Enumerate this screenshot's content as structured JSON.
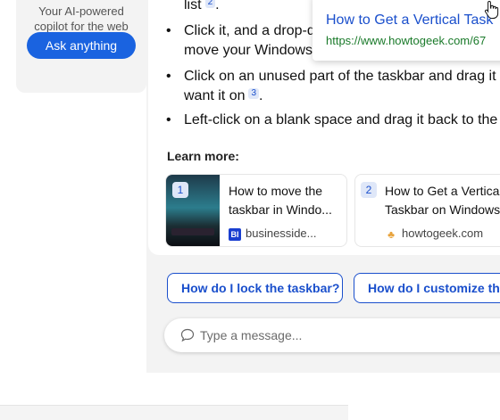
{
  "promo": {
    "text_line1": "Your AI-powered",
    "text_line2": "copilot for the web",
    "button_label": "Ask anything"
  },
  "answer": {
    "bullets": [
      {
        "line1": "list",
        "cite": "2",
        "line1_tail": "."
      },
      {
        "line1": "Click it, and a drop-d",
        "line2": "move your Windows"
      },
      {
        "line1": "Click on an unused part of the taskbar and drag it",
        "line2": "want it on",
        "cite": "3",
        "line2_tail": "."
      },
      {
        "line1": "Left-click on a blank space and drag it back to the"
      }
    ],
    "learn_more_label": "Learn more:",
    "sources": [
      {
        "num": "1",
        "title_line1": "How to move the",
        "title_line2": "taskbar in Windo...",
        "favicon": "BI",
        "site": "businesside..."
      },
      {
        "num": "2",
        "title_line1": "How to Get a Vertical",
        "title_line2": "Taskbar on Windows",
        "favicon": "♣",
        "site": "howtogeek.com"
      }
    ]
  },
  "suggestions": [
    "How do I lock the taskbar?",
    "How do I customize the"
  ],
  "input": {
    "placeholder": "Type a message..."
  },
  "tooltip": {
    "title": "How to Get a Vertical Task",
    "url": "https://www.howtogeek.com/67"
  },
  "colors": {
    "accent": "#1a63e0",
    "link": "#1a4fcc",
    "url_green": "#1a7a2a"
  }
}
